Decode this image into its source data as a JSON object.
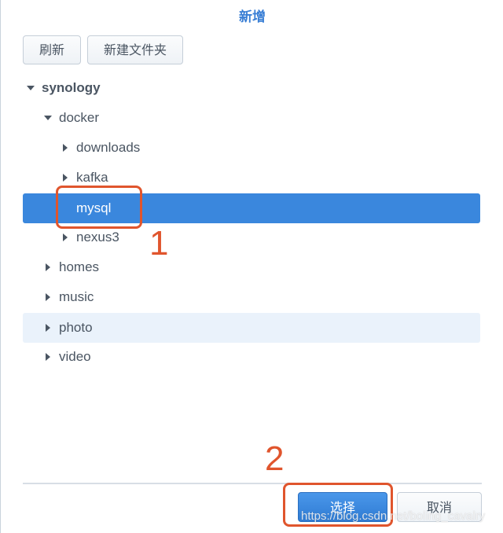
{
  "dialog": {
    "title": "新增"
  },
  "toolbar": {
    "refresh_label": "刷新",
    "new_folder_label": "新建文件夹"
  },
  "tree": {
    "root": "synology",
    "docker": "docker",
    "downloads": "downloads",
    "kafka": "kafka",
    "mysql": "mysql",
    "nexus3": "nexus3",
    "homes": "homes",
    "music": "music",
    "photo": "photo",
    "video": "video"
  },
  "annotations": {
    "step1": "1",
    "step2": "2"
  },
  "footer": {
    "select_label": "选择",
    "cancel_label": "取消"
  },
  "watermark": "https://blog.csdn.net/boling_cavalry",
  "colors": {
    "accent": "#3a87dd",
    "annotation": "#e0552d"
  }
}
